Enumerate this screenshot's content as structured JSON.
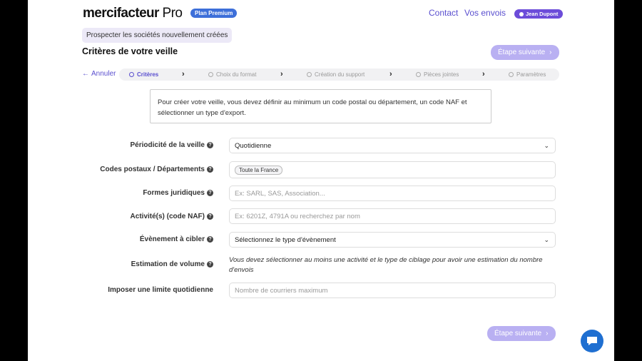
{
  "header": {
    "logo_main": "mercifacteur",
    "logo_pro": "Pro",
    "plan": "Plan Premium",
    "nav": [
      "Contact",
      "Vos envois"
    ],
    "user": "Jean Dupont"
  },
  "subtitle": "Prospecter les sociétés nouvellement créées",
  "title": "Critères de votre veille",
  "next_label": "Étape suivante",
  "cancel_label": "Annuler",
  "steps": [
    "Critères",
    "Choix du format",
    "Création du support",
    "Pièces jointes",
    "Paramètres"
  ],
  "info": "Pour créer votre veille, vous devez définir au minimum un code postal ou département, un code NAF et sélectionner un type d'export.",
  "form": {
    "periodicite": {
      "label": "Périodicité de la veille",
      "value": "Quotidienne"
    },
    "codes": {
      "label": "Codes postaux / Départements",
      "tag": "Toute la France"
    },
    "formes": {
      "label": "Formes juridiques",
      "placeholder": "Ex: SARL, SAS, Association..."
    },
    "naf": {
      "label": "Activité(s) (code NAF)",
      "placeholder": "Ex: 6201Z, 4791A ou recherchez par nom"
    },
    "evenement": {
      "label": "Évènement à cibler",
      "value": "Sélectionnez le type d'évènement"
    },
    "estimation": {
      "label": "Estimation de volume",
      "text": "Vous devez sélectionner au moins une activité et le type de ciblage pour avoir une estimation du nombre d'envois"
    },
    "limite": {
      "label": "Imposer une limite quotidienne",
      "placeholder": "Nombre de courriers maximum"
    }
  }
}
